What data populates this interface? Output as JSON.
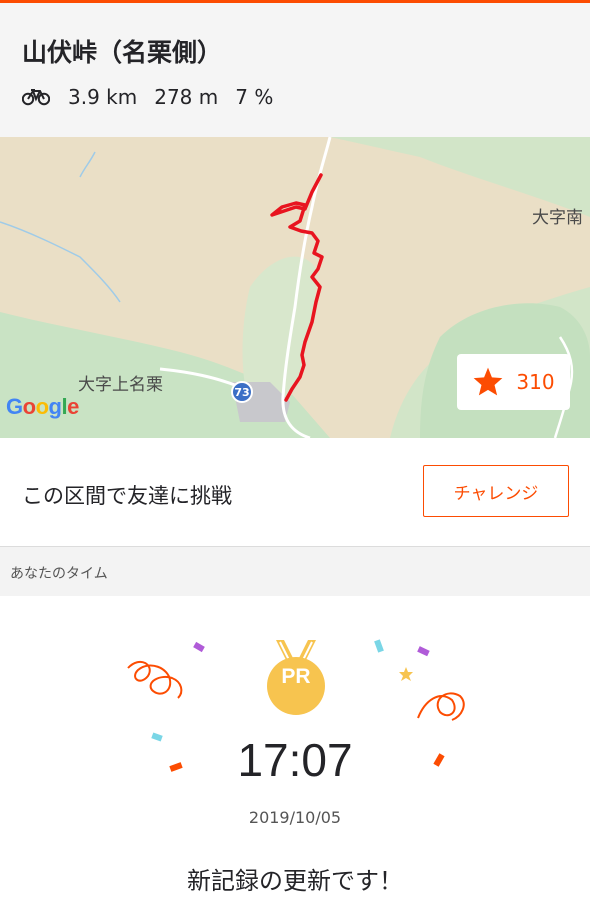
{
  "segment": {
    "title": "山伏峠（名栗側）",
    "distance": "3.9 km",
    "elevation": "278 m",
    "grade": "7 %",
    "activity_icon": "bike-icon"
  },
  "map": {
    "label_left": "大字上名栗",
    "label_right": "大字南",
    "route_badge": "73",
    "attribution": "Google",
    "route_color": "#e8141f"
  },
  "kudos": {
    "icon": "star-icon",
    "count": "310"
  },
  "challenge": {
    "text": "この区間で友達に挑戦",
    "button_label": "チャレンジ"
  },
  "your_time": {
    "section_label": "あなたのタイム",
    "badge": "PR",
    "time": "17:07",
    "date": "2019/10/05",
    "message": "新記録の更新です！"
  },
  "colors": {
    "accent": "#fc4c02",
    "medal": "#f7c44f"
  }
}
